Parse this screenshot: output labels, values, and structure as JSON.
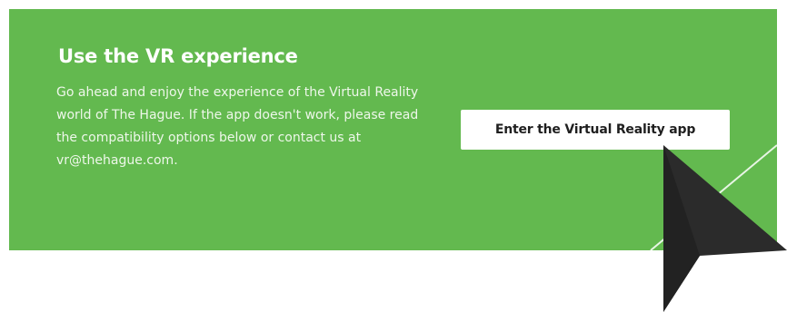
{
  "banner": {
    "title": "Use the VR experience",
    "description": "Go ahead and enjoy the experience of the Virtual Reality world of The Hague. If the app doesn't work, please read the compatibility options below or contact us at vr@thehague.com.",
    "cta_label": "Enter the Virtual Reality app"
  },
  "colors": {
    "panel_background": "#63b94f",
    "text": "#ffffff",
    "button_background": "#ffffff",
    "button_text": "#1f1f1f",
    "cursor": "#2b2b2b"
  },
  "icons": {
    "cursor": "mouse-pointer-arrow-icon"
  }
}
